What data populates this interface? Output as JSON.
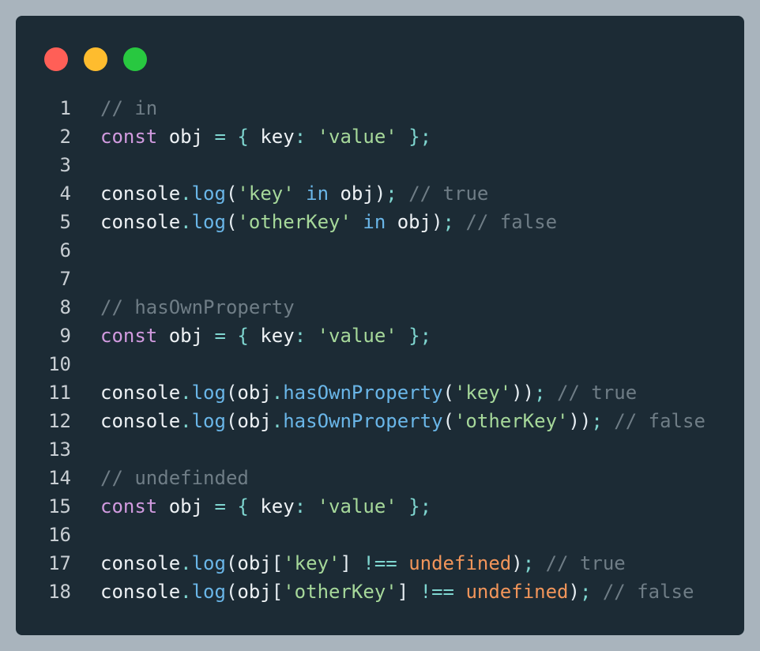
{
  "window": {
    "traffic_lights": [
      {
        "name": "close",
        "color": "#ff5f57"
      },
      {
        "name": "minimize",
        "color": "#febc2e"
      },
      {
        "name": "maximize",
        "color": "#28c840"
      }
    ]
  },
  "colors": {
    "background": "#a9b4bd",
    "editor_bg": "#1c2b35",
    "comment": "#6f7d86",
    "keyword": "#d29be0",
    "identifier": "#eef2f5",
    "punctuation": "#7fd6d0",
    "string": "#a6d89a",
    "method": "#6ab6e8",
    "literal": "#f2955a"
  },
  "code": {
    "lines": [
      {
        "number": "1",
        "tokens": [
          {
            "t": "comment",
            "v": "// in"
          }
        ]
      },
      {
        "number": "2",
        "tokens": [
          {
            "t": "keyword",
            "v": "const"
          },
          {
            "t": "plain",
            "v": " "
          },
          {
            "t": "ident",
            "v": "obj"
          },
          {
            "t": "plain",
            "v": " "
          },
          {
            "t": "punct",
            "v": "="
          },
          {
            "t": "plain",
            "v": " "
          },
          {
            "t": "punct",
            "v": "{"
          },
          {
            "t": "plain",
            "v": " "
          },
          {
            "t": "ident",
            "v": "key"
          },
          {
            "t": "punct",
            "v": ":"
          },
          {
            "t": "plain",
            "v": " "
          },
          {
            "t": "string",
            "v": "'value'"
          },
          {
            "t": "plain",
            "v": " "
          },
          {
            "t": "punct",
            "v": "};"
          }
        ]
      },
      {
        "number": "3",
        "tokens": []
      },
      {
        "number": "4",
        "tokens": [
          {
            "t": "ident",
            "v": "console"
          },
          {
            "t": "punct",
            "v": "."
          },
          {
            "t": "method",
            "v": "log"
          },
          {
            "t": "plain",
            "v": "("
          },
          {
            "t": "string",
            "v": "'key'"
          },
          {
            "t": "plain",
            "v": " "
          },
          {
            "t": "method",
            "v": "in"
          },
          {
            "t": "plain",
            "v": " "
          },
          {
            "t": "ident",
            "v": "obj"
          },
          {
            "t": "plain",
            "v": ")"
          },
          {
            "t": "punct",
            "v": ";"
          },
          {
            "t": "plain",
            "v": " "
          },
          {
            "t": "comment",
            "v": "// true"
          }
        ]
      },
      {
        "number": "5",
        "tokens": [
          {
            "t": "ident",
            "v": "console"
          },
          {
            "t": "punct",
            "v": "."
          },
          {
            "t": "method",
            "v": "log"
          },
          {
            "t": "plain",
            "v": "("
          },
          {
            "t": "string",
            "v": "'otherKey'"
          },
          {
            "t": "plain",
            "v": " "
          },
          {
            "t": "method",
            "v": "in"
          },
          {
            "t": "plain",
            "v": " "
          },
          {
            "t": "ident",
            "v": "obj"
          },
          {
            "t": "plain",
            "v": ")"
          },
          {
            "t": "punct",
            "v": ";"
          },
          {
            "t": "plain",
            "v": " "
          },
          {
            "t": "comment",
            "v": "// false"
          }
        ]
      },
      {
        "number": "6",
        "tokens": []
      },
      {
        "number": "7",
        "tokens": []
      },
      {
        "number": "8",
        "tokens": [
          {
            "t": "comment",
            "v": "// hasOwnProperty"
          }
        ]
      },
      {
        "number": "9",
        "tokens": [
          {
            "t": "keyword",
            "v": "const"
          },
          {
            "t": "plain",
            "v": " "
          },
          {
            "t": "ident",
            "v": "obj"
          },
          {
            "t": "plain",
            "v": " "
          },
          {
            "t": "punct",
            "v": "="
          },
          {
            "t": "plain",
            "v": " "
          },
          {
            "t": "punct",
            "v": "{"
          },
          {
            "t": "plain",
            "v": " "
          },
          {
            "t": "ident",
            "v": "key"
          },
          {
            "t": "punct",
            "v": ":"
          },
          {
            "t": "plain",
            "v": " "
          },
          {
            "t": "string",
            "v": "'value'"
          },
          {
            "t": "plain",
            "v": " "
          },
          {
            "t": "punct",
            "v": "};"
          }
        ]
      },
      {
        "number": "10",
        "tokens": []
      },
      {
        "number": "11",
        "tokens": [
          {
            "t": "ident",
            "v": "console"
          },
          {
            "t": "punct",
            "v": "."
          },
          {
            "t": "method",
            "v": "log"
          },
          {
            "t": "plain",
            "v": "("
          },
          {
            "t": "ident",
            "v": "obj"
          },
          {
            "t": "punct",
            "v": "."
          },
          {
            "t": "method",
            "v": "hasOwnProperty"
          },
          {
            "t": "plain",
            "v": "("
          },
          {
            "t": "string",
            "v": "'key'"
          },
          {
            "t": "plain",
            "v": "))"
          },
          {
            "t": "punct",
            "v": ";"
          },
          {
            "t": "plain",
            "v": " "
          },
          {
            "t": "comment",
            "v": "// true"
          }
        ]
      },
      {
        "number": "12",
        "tokens": [
          {
            "t": "ident",
            "v": "console"
          },
          {
            "t": "punct",
            "v": "."
          },
          {
            "t": "method",
            "v": "log"
          },
          {
            "t": "plain",
            "v": "("
          },
          {
            "t": "ident",
            "v": "obj"
          },
          {
            "t": "punct",
            "v": "."
          },
          {
            "t": "method",
            "v": "hasOwnProperty"
          },
          {
            "t": "plain",
            "v": "("
          },
          {
            "t": "string",
            "v": "'otherKey'"
          },
          {
            "t": "plain",
            "v": "))"
          },
          {
            "t": "punct",
            "v": ";"
          },
          {
            "t": "plain",
            "v": " "
          },
          {
            "t": "comment",
            "v": "// false"
          }
        ]
      },
      {
        "number": "13",
        "tokens": []
      },
      {
        "number": "14",
        "tokens": [
          {
            "t": "comment",
            "v": "// undefinded"
          }
        ]
      },
      {
        "number": "15",
        "tokens": [
          {
            "t": "keyword",
            "v": "const"
          },
          {
            "t": "plain",
            "v": " "
          },
          {
            "t": "ident",
            "v": "obj"
          },
          {
            "t": "plain",
            "v": " "
          },
          {
            "t": "punct",
            "v": "="
          },
          {
            "t": "plain",
            "v": " "
          },
          {
            "t": "punct",
            "v": "{"
          },
          {
            "t": "plain",
            "v": " "
          },
          {
            "t": "ident",
            "v": "key"
          },
          {
            "t": "punct",
            "v": ":"
          },
          {
            "t": "plain",
            "v": " "
          },
          {
            "t": "string",
            "v": "'value'"
          },
          {
            "t": "plain",
            "v": " "
          },
          {
            "t": "punct",
            "v": "};"
          }
        ]
      },
      {
        "number": "16",
        "tokens": []
      },
      {
        "number": "17",
        "tokens": [
          {
            "t": "ident",
            "v": "console"
          },
          {
            "t": "punct",
            "v": "."
          },
          {
            "t": "method",
            "v": "log"
          },
          {
            "t": "plain",
            "v": "("
          },
          {
            "t": "ident",
            "v": "obj"
          },
          {
            "t": "plain",
            "v": "["
          },
          {
            "t": "string",
            "v": "'key'"
          },
          {
            "t": "plain",
            "v": "]"
          },
          {
            "t": "plain",
            "v": " "
          },
          {
            "t": "punct",
            "v": "!=="
          },
          {
            "t": "plain",
            "v": " "
          },
          {
            "t": "literal",
            "v": "undefined"
          },
          {
            "t": "plain",
            "v": ")"
          },
          {
            "t": "punct",
            "v": ";"
          },
          {
            "t": "plain",
            "v": " "
          },
          {
            "t": "comment",
            "v": "// true"
          }
        ]
      },
      {
        "number": "18",
        "tokens": [
          {
            "t": "ident",
            "v": "console"
          },
          {
            "t": "punct",
            "v": "."
          },
          {
            "t": "method",
            "v": "log"
          },
          {
            "t": "plain",
            "v": "("
          },
          {
            "t": "ident",
            "v": "obj"
          },
          {
            "t": "plain",
            "v": "["
          },
          {
            "t": "string",
            "v": "'otherKey'"
          },
          {
            "t": "plain",
            "v": "]"
          },
          {
            "t": "plain",
            "v": " "
          },
          {
            "t": "punct",
            "v": "!=="
          },
          {
            "t": "plain",
            "v": " "
          },
          {
            "t": "literal",
            "v": "undefined"
          },
          {
            "t": "plain",
            "v": ")"
          },
          {
            "t": "punct",
            "v": ";"
          },
          {
            "t": "plain",
            "v": " "
          },
          {
            "t": "comment",
            "v": "// false"
          }
        ]
      }
    ]
  }
}
